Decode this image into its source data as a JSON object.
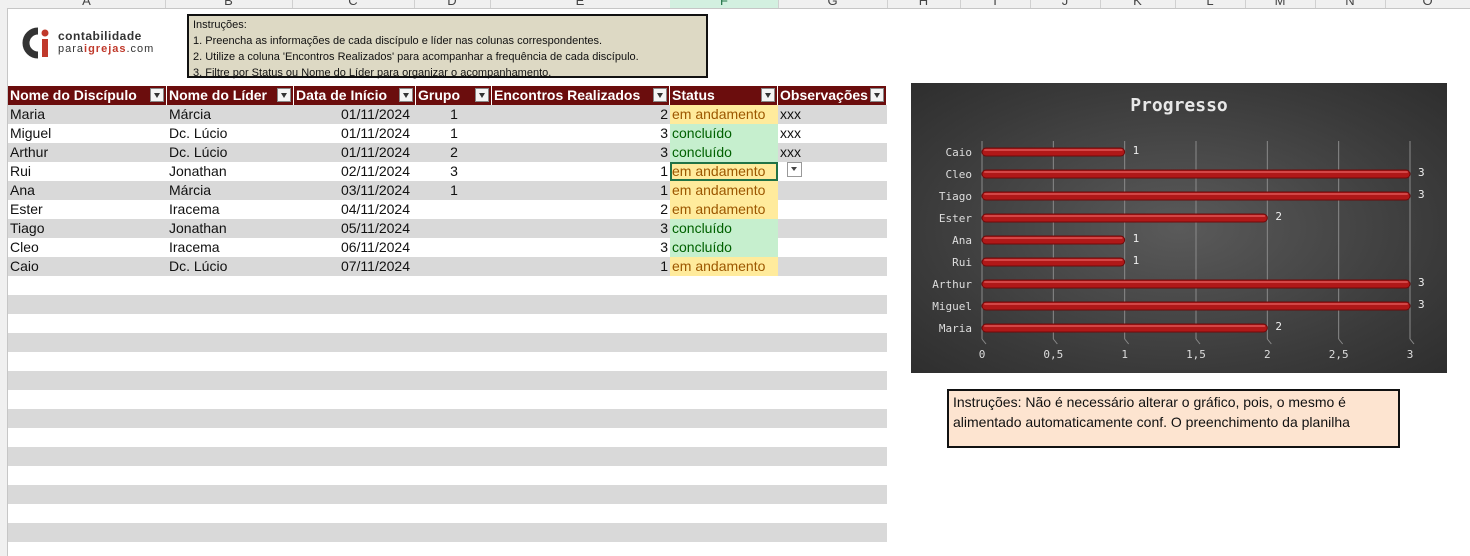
{
  "columns": [
    "A",
    "B",
    "C",
    "D",
    "E",
    "F",
    "G",
    "H",
    "I",
    "J",
    "K",
    "L",
    "M",
    "N",
    "O"
  ],
  "logo": {
    "line1": "contabilidade",
    "line2a": "para",
    "line2b": "igrejas",
    "line2c": ".com"
  },
  "instructions": {
    "title": "Instruções:",
    "lines": [
      "1. Preencha as informações de cada discípulo e líder nas colunas correspondentes.",
      "2. Utilize a coluna 'Encontros Realizados' para acompanhar a frequência de cada discípulo.",
      "3. Filtre por Status ou Nome do Líder para organizar o acompanhamento."
    ]
  },
  "table": {
    "headers": [
      "Nome do Discípulo",
      "Nome do Líder",
      "Data de Início",
      "Grupo",
      "Encontros Realizados",
      "Status",
      "Observações"
    ],
    "rows": [
      {
        "nome": "Maria",
        "lider": "Márcia",
        "data": "01/11/2024",
        "grupo": "1",
        "encontros": "2",
        "status": "em andamento",
        "obs": "xxx"
      },
      {
        "nome": "Miguel",
        "lider": "Dc. Lúcio",
        "data": "01/11/2024",
        "grupo": "1",
        "encontros": "3",
        "status": "concluído",
        "obs": "xxx"
      },
      {
        "nome": "Arthur",
        "lider": "Dc. Lúcio",
        "data": "01/11/2024",
        "grupo": "2",
        "encontros": "3",
        "status": "concluído",
        "obs": "xxx"
      },
      {
        "nome": "Rui",
        "lider": "Jonathan",
        "data": "02/11/2024",
        "grupo": "3",
        "encontros": "1",
        "status": "em andamento",
        "obs": ""
      },
      {
        "nome": "Ana",
        "lider": "Márcia",
        "data": "03/11/2024",
        "grupo": "1",
        "encontros": "1",
        "status": "em andamento",
        "obs": ""
      },
      {
        "nome": "Ester",
        "lider": "Iracema",
        "data": "04/11/2024",
        "grupo": "",
        "encontros": "2",
        "status": "em andamento",
        "obs": ""
      },
      {
        "nome": "Tiago",
        "lider": "Jonathan",
        "data": "05/11/2024",
        "grupo": "",
        "encontros": "3",
        "status": "concluído",
        "obs": ""
      },
      {
        "nome": "Cleo",
        "lider": "Iracema",
        "data": "06/11/2024",
        "grupo": "",
        "encontros": "3",
        "status": "concluído",
        "obs": ""
      },
      {
        "nome": "Caio",
        "lider": "Dc. Lúcio",
        "data": "07/11/2024",
        "grupo": "",
        "encontros": "1",
        "status": "em andamento",
        "obs": ""
      }
    ]
  },
  "colors": {
    "header_bg": "#6b0d0d",
    "band": "#d9d9d9",
    "in_progress_bg": "#ffeb9c",
    "in_progress_fg": "#9c5700",
    "done_bg": "#c6efce",
    "done_fg": "#006100",
    "bar": "#b01818"
  },
  "chart_data": {
    "type": "bar",
    "orientation": "horizontal",
    "title": "Progresso",
    "categories": [
      "Caio",
      "Cleo",
      "Tiago",
      "Ester",
      "Ana",
      "Rui",
      "Arthur",
      "Miguel",
      "Maria"
    ],
    "values": [
      1,
      3,
      3,
      2,
      1,
      1,
      3,
      3,
      2
    ],
    "xlim": [
      0,
      3
    ],
    "xticks": [
      "0",
      "0,5",
      "1",
      "1,5",
      "2",
      "2,5",
      "3"
    ],
    "grid": true,
    "data_labels": true
  },
  "note": "Instruções: Não é necessário alterar o gráfico, pois, o mesmo é alimentado automaticamente conf. O preenchimento da planilha"
}
